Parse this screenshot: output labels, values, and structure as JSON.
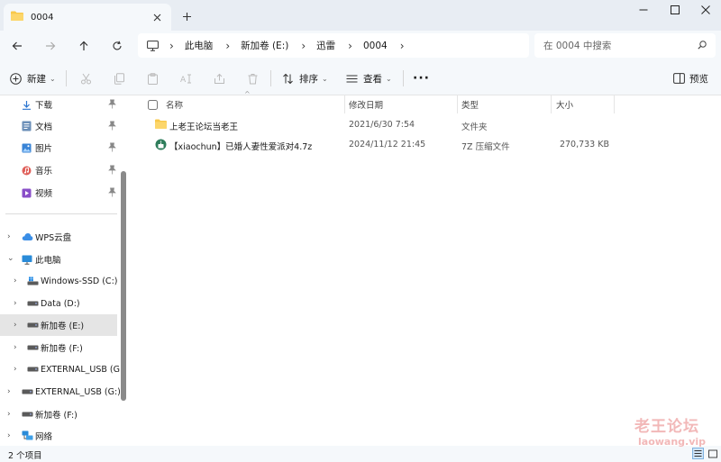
{
  "tab": {
    "title": "0004"
  },
  "address": {
    "crumbs": [
      "此电脑",
      "新加卷 (E:)",
      "迅雷",
      "0004"
    ]
  },
  "search": {
    "placeholder": "在 0004 中搜索"
  },
  "toolbar": {
    "new_label": "新建",
    "sort_label": "排序",
    "view_label": "查看",
    "preview_label": "预览"
  },
  "nav": {
    "quick": [
      {
        "label": "下载",
        "icon": "download-icon"
      },
      {
        "label": "文档",
        "icon": "document-icon"
      },
      {
        "label": "图片",
        "icon": "picture-icon"
      },
      {
        "label": "音乐",
        "icon": "music-icon"
      },
      {
        "label": "视频",
        "icon": "video-icon"
      }
    ],
    "tree": [
      {
        "label": "WPS云盘",
        "icon": "cloud-icon"
      },
      {
        "label": "此电脑",
        "icon": "computer-icon"
      },
      {
        "label": "Windows-SSD (C:)",
        "icon": "windows-drive-icon"
      },
      {
        "label": "Data (D:)",
        "icon": "drive-icon"
      },
      {
        "label": "新加卷 (E:)",
        "icon": "drive-icon"
      },
      {
        "label": "新加卷 (F:)",
        "icon": "drive-icon"
      },
      {
        "label": "EXTERNAL_USB (G:)",
        "icon": "drive-icon"
      },
      {
        "label": "EXTERNAL_USB (G:)",
        "icon": "drive-icon"
      },
      {
        "label": "新加卷 (F:)",
        "icon": "drive-icon"
      },
      {
        "label": "网络",
        "icon": "network-icon"
      }
    ]
  },
  "columns": {
    "name": "名称",
    "modified": "修改日期",
    "type": "类型",
    "size": "大小"
  },
  "files": [
    {
      "name": "上老王论坛当老王",
      "modified": "2021/6/30 7:54",
      "type": "文件夹",
      "size": "",
      "icon": "folder-icon"
    },
    {
      "name": "【xiaochun】已婚人妻性爱派对4.7z",
      "modified": "2024/11/12 21:45",
      "type": "7Z 压缩文件",
      "size": "270,733 KB",
      "icon": "archive-icon"
    }
  ],
  "status": {
    "count": "2 个项目"
  },
  "watermark": {
    "main": "老王论坛",
    "sub": "laowang.vip"
  },
  "colors": {
    "accent": "#0067c0",
    "folder": "#f8c84a",
    "selected": "#e5e5e5",
    "chrome": "#f5f8fb",
    "tabbar": "#e8edf3"
  }
}
